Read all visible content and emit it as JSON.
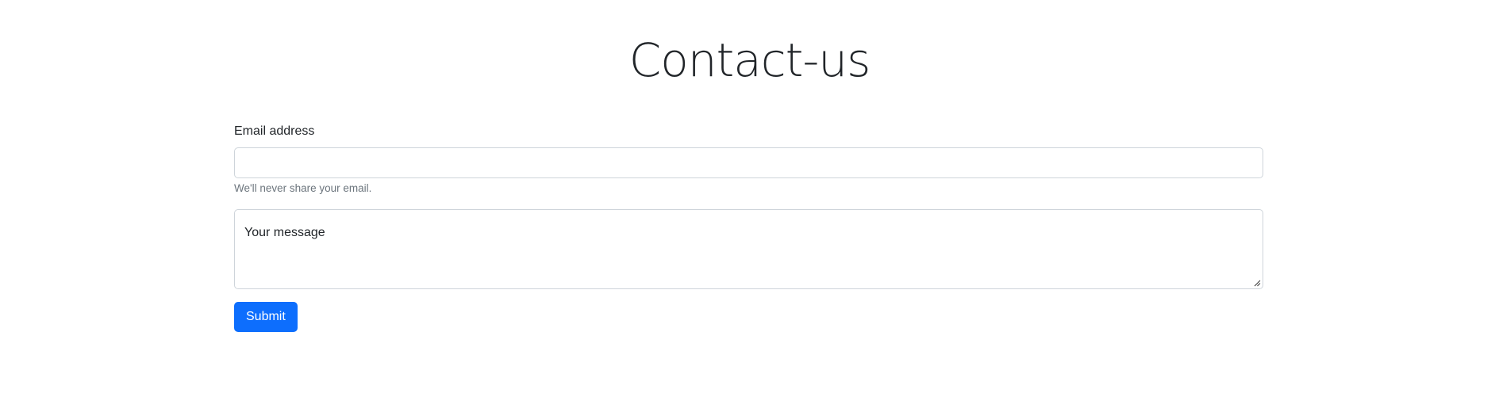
{
  "page": {
    "title": "Contact-us"
  },
  "form": {
    "email_label": "Email address",
    "email_value": "",
    "email_placeholder": "",
    "email_help": "We'll never share your email.",
    "message_placeholder": "Your message",
    "submit_label": "Submit"
  },
  "colors": {
    "primary": "#0d6efd",
    "text": "#212529",
    "muted": "#6c757d",
    "border": "#ced4da"
  },
  "icons": {
    "resize_handle": "resize-grip-icon"
  }
}
